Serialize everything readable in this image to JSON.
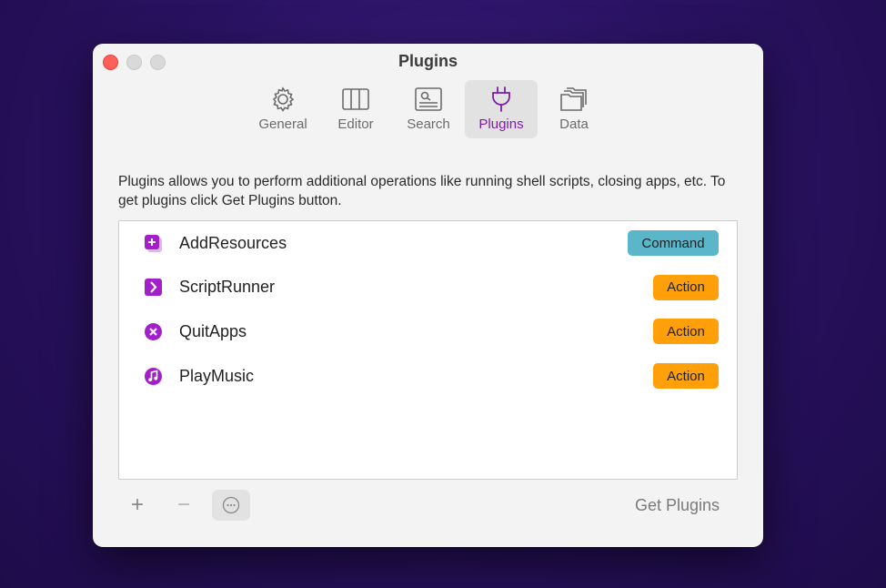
{
  "window": {
    "title": "Plugins"
  },
  "toolbar": {
    "tabs": [
      {
        "label": "General",
        "icon": "gear-icon",
        "active": false
      },
      {
        "label": "Editor",
        "icon": "columns-icon",
        "active": false
      },
      {
        "label": "Search",
        "icon": "search-window-icon",
        "active": false
      },
      {
        "label": "Plugins",
        "icon": "plug-icon",
        "active": true
      },
      {
        "label": "Data",
        "icon": "folders-icon",
        "active": false
      }
    ]
  },
  "description": "Plugins allows you to perform additional operations like running shell scripts, closing apps, etc. To get plugins click Get Plugins button.",
  "plugins": [
    {
      "name": "AddResources",
      "icon": "plus-square-icon",
      "type": "Command",
      "type_color": "#5ab6c8"
    },
    {
      "name": "ScriptRunner",
      "icon": "chevron-square-icon",
      "type": "Action",
      "type_color": "#ff9f0a"
    },
    {
      "name": "QuitApps",
      "icon": "x-circle-icon",
      "type": "Action",
      "type_color": "#ff9f0a"
    },
    {
      "name": "PlayMusic",
      "icon": "music-note-icon",
      "type": "Action",
      "type_color": "#ff9f0a"
    }
  ],
  "bottom_bar": {
    "add_label": "+",
    "remove_label": "−",
    "get_plugins_label": "Get Plugins"
  },
  "colors": {
    "accent": "#7d1fa4",
    "plugin_icon": "#a31fc9"
  }
}
